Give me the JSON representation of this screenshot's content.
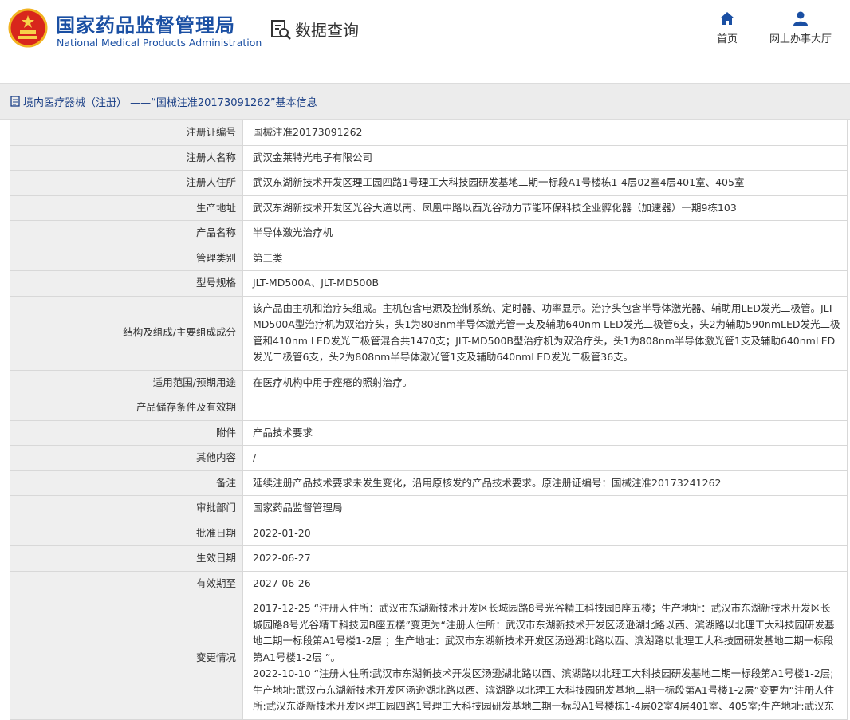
{
  "header": {
    "brand_cn": "国家药品监督管理局",
    "brand_en": "National Medical Products Administration",
    "query_label": "数据查询",
    "nav": [
      {
        "label": "首页",
        "icon": "home-icon"
      },
      {
        "label": "网上办事大厅",
        "icon": "user-icon"
      }
    ]
  },
  "breadcrumb": "境内医疗器械（注册） ——“国械注准20173091262”基本信息",
  "rows": [
    {
      "label": "注册证编号",
      "value": "国械注准20173091262"
    },
    {
      "label": "注册人名称",
      "value": "武汉金莱特光电子有限公司"
    },
    {
      "label": "注册人住所",
      "value": "武汉东湖新技术开发区理工园四路1号理工大科技园研发基地二期一标段A1号楼栋1-4层02室4层401室、405室"
    },
    {
      "label": "生产地址",
      "value": "武汉东湖新技术开发区光谷大道以南、凤凰中路以西光谷动力节能环保科技企业孵化器（加速器）一期9栋103"
    },
    {
      "label": "产品名称",
      "value": "半导体激光治疗机"
    },
    {
      "label": "管理类别",
      "value": "第三类"
    },
    {
      "label": "型号规格",
      "value": "JLT-MD500A、JLT-MD500B"
    },
    {
      "label": "结构及组成/主要组成成分",
      "value": "该产品由主机和治疗头组成。主机包含电源及控制系统、定时器、功率显示。治疗头包含半导体激光器、辅助用LED发光二极管。JLT-MD500A型治疗机为双治疗头，头1为808nm半导体激光管一支及辅助640nm LED发光二极管6支，头2为辅助590nmLED发光二极管和410nm LED发光二极管混合共1470支；JLT-MD500B型治疗机为双治疗头，头1为808nm半导体激光管1支及辅助640nmLED发光二极管6支，头2为808nm半导体激光管1支及辅助640nmLED发光二极管36支。"
    },
    {
      "label": "适用范围/预期用途",
      "value": "在医疗机构中用于痤疮的照射治疗。"
    },
    {
      "label": "产品储存条件及有效期",
      "value": ""
    },
    {
      "label": "附件",
      "value": "产品技术要求"
    },
    {
      "label": "其他内容",
      "value": "/"
    },
    {
      "label": "备注",
      "value": "延续注册产品技术要求未发生变化，沿用原核发的产品技术要求。原注册证编号：国械注准20173241262"
    },
    {
      "label": "审批部门",
      "value": "国家药品监督管理局"
    },
    {
      "label": "批准日期",
      "value": "2022-01-20"
    },
    {
      "label": "生效日期",
      "value": "2022-06-27"
    },
    {
      "label": "有效期至",
      "value": "2027-06-26"
    }
  ],
  "changes": {
    "label": "变更情况",
    "entries": [
      "2017-12-25 “注册人住所：武汉市东湖新技术开发区长城园路8号光谷精工科技园B座五楼；生产地址：武汉市东湖新技术开发区长城园路8号光谷精工科技园B座五楼”变更为“注册人住所：武汉市东湖新技术开发区汤逊湖北路以西、滨湖路以北理工大科技园研发基地二期一标段第A1号楼1-2层 ；生产地址：武汉市东湖新技术开发区汤逊湖北路以西、滨湖路以北理工大科技园研发基地二期一标段第A1号楼1-2层 ”。",
      "2022-10-10 “注册人住所:武汉市东湖新技术开发区汤逊湖北路以西、滨湖路以北理工大科技园研发基地二期一标段第A1号楼1-2层;生产地址:武汉市东湖新技术开发区汤逊湖北路以西、滨湖路以北理工大科技园研发基地二期一标段第A1号楼1-2层”变更为“注册人住所:武汉东湖新技术开发区理工园四路1号理工大科技园研发基地二期一标段A1号楼栋1-4层02室4层401室、405室;生产地址:武汉东"
    ]
  },
  "colors": {
    "brand_blue": "#1a4fa3",
    "label_bg": "#efefef",
    "crumb_bg": "#ececec"
  }
}
